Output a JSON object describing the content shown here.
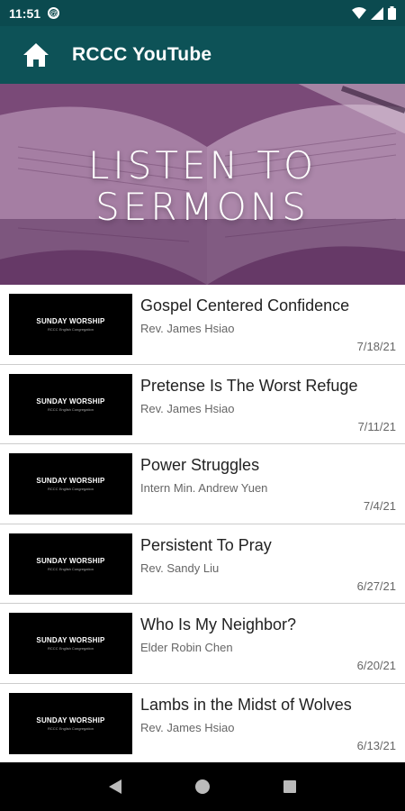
{
  "status": {
    "time": "11:51",
    "notif_glyph": "@"
  },
  "app_bar": {
    "title": "RCCC YouTube"
  },
  "banner": {
    "line1": "LISTEN TO",
    "line2": "SERMONS"
  },
  "thumbnail": {
    "title": "SUNDAY WORSHIP",
    "subtitle": "RCCC English Congregation"
  },
  "sermons": [
    {
      "title": "Gospel Centered Confidence",
      "speaker": "Rev. James Hsiao",
      "date": "7/18/21"
    },
    {
      "title": "Pretense Is The Worst Refuge",
      "speaker": "Rev. James Hsiao",
      "date": "7/11/21"
    },
    {
      "title": "Power Struggles",
      "speaker": "Intern Min. Andrew Yuen",
      "date": "7/4/21"
    },
    {
      "title": "Persistent To Pray",
      "speaker": "Rev. Sandy Liu",
      "date": "6/27/21"
    },
    {
      "title": "Who Is My Neighbor?",
      "speaker": "Elder Robin Chen",
      "date": "6/20/21"
    },
    {
      "title": "Lambs in the Midst of Wolves",
      "speaker": "Rev. James Hsiao",
      "date": "6/13/21"
    }
  ],
  "colors": {
    "app_bar": "#0d5257",
    "status_bar": "#0b4a4f",
    "banner_tint": "#6d3d6e"
  }
}
